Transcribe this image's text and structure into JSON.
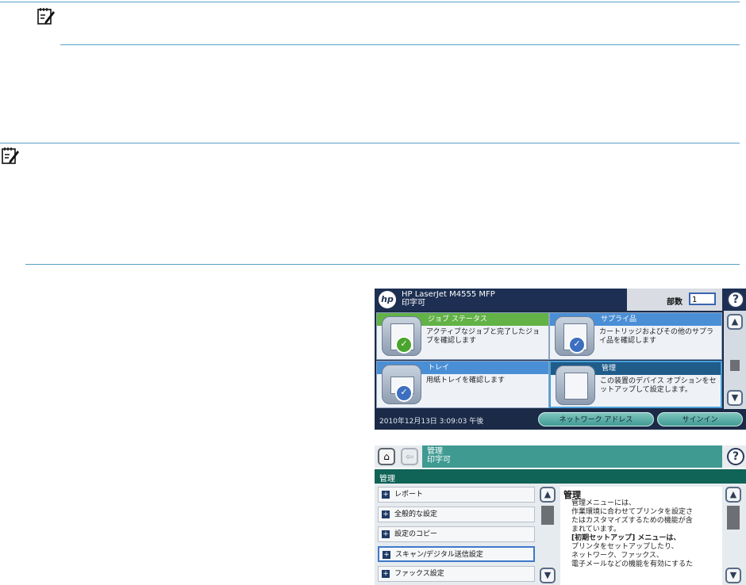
{
  "screen1": {
    "product": "HP LaserJet M4555 MFP",
    "status": "印字可",
    "copies_label": "部数",
    "copies_value": "1",
    "help": "?",
    "tiles": [
      {
        "title": "ジョブ ステータス",
        "desc": "アクティブなジョブと完了したジョブを確認します"
      },
      {
        "title": "サプライ品",
        "desc": "カートリッジおよびその他のサプライ品を確認します"
      },
      {
        "title": "トレイ",
        "desc": "用紙トレイを確認します"
      },
      {
        "title": "管理",
        "desc": "この装置のデバイス オプションをセットアップして設定します。"
      }
    ],
    "footer_time": "2010年12月13日 3:09:03 午後",
    "network_button": "ネットワーク アドレス",
    "signin_button": "サインイン"
  },
  "screen2": {
    "title": "管理",
    "status": "印字可",
    "section": "管理",
    "menu": [
      "レポート",
      "全般的な設定",
      "設定のコピー",
      "スキャン/デジタル送信設定",
      "ファックス設定"
    ],
    "help_title": "管理",
    "help_lines": [
      "管理メニューには、",
      "作業環境に合わせてプリンタを設定さ",
      "たはカスタマイズするための機能が含",
      "まれています。",
      "[初期セットアップ] メニューは、",
      "プリンタをセットアップしたり、",
      "ネットワーク、ファックス、",
      "電子メールなどの機能を有効にするた"
    ]
  },
  "colors": {
    "rule": "#5a9fc8",
    "hp_navy": "#1d2f52",
    "teal": "#3f9a92",
    "dark_teal": "#0f6357",
    "green_header": "#62b246",
    "blue_header": "#4a8fd6"
  }
}
